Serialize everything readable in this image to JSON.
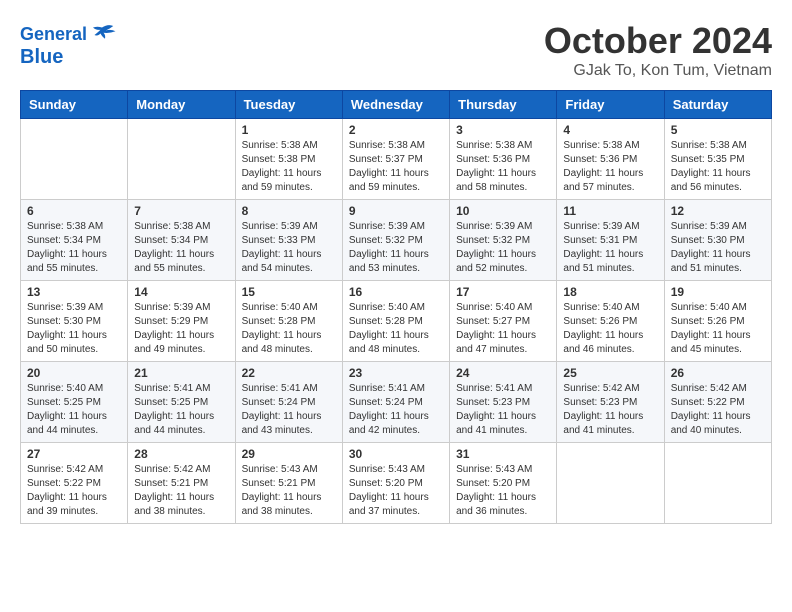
{
  "header": {
    "logo_line1": "General",
    "logo_line2": "Blue",
    "month": "October 2024",
    "location": "GJak To, Kon Tum, Vietnam"
  },
  "weekdays": [
    "Sunday",
    "Monday",
    "Tuesday",
    "Wednesday",
    "Thursday",
    "Friday",
    "Saturday"
  ],
  "weeks": [
    [
      {
        "day": "",
        "data": ""
      },
      {
        "day": "",
        "data": ""
      },
      {
        "day": "1",
        "data": "Sunrise: 5:38 AM\nSunset: 5:38 PM\nDaylight: 11 hours and 59 minutes."
      },
      {
        "day": "2",
        "data": "Sunrise: 5:38 AM\nSunset: 5:37 PM\nDaylight: 11 hours and 59 minutes."
      },
      {
        "day": "3",
        "data": "Sunrise: 5:38 AM\nSunset: 5:36 PM\nDaylight: 11 hours and 58 minutes."
      },
      {
        "day": "4",
        "data": "Sunrise: 5:38 AM\nSunset: 5:36 PM\nDaylight: 11 hours and 57 minutes."
      },
      {
        "day": "5",
        "data": "Sunrise: 5:38 AM\nSunset: 5:35 PM\nDaylight: 11 hours and 56 minutes."
      }
    ],
    [
      {
        "day": "6",
        "data": "Sunrise: 5:38 AM\nSunset: 5:34 PM\nDaylight: 11 hours and 55 minutes."
      },
      {
        "day": "7",
        "data": "Sunrise: 5:38 AM\nSunset: 5:34 PM\nDaylight: 11 hours and 55 minutes."
      },
      {
        "day": "8",
        "data": "Sunrise: 5:39 AM\nSunset: 5:33 PM\nDaylight: 11 hours and 54 minutes."
      },
      {
        "day": "9",
        "data": "Sunrise: 5:39 AM\nSunset: 5:32 PM\nDaylight: 11 hours and 53 minutes."
      },
      {
        "day": "10",
        "data": "Sunrise: 5:39 AM\nSunset: 5:32 PM\nDaylight: 11 hours and 52 minutes."
      },
      {
        "day": "11",
        "data": "Sunrise: 5:39 AM\nSunset: 5:31 PM\nDaylight: 11 hours and 51 minutes."
      },
      {
        "day": "12",
        "data": "Sunrise: 5:39 AM\nSunset: 5:30 PM\nDaylight: 11 hours and 51 minutes."
      }
    ],
    [
      {
        "day": "13",
        "data": "Sunrise: 5:39 AM\nSunset: 5:30 PM\nDaylight: 11 hours and 50 minutes."
      },
      {
        "day": "14",
        "data": "Sunrise: 5:39 AM\nSunset: 5:29 PM\nDaylight: 11 hours and 49 minutes."
      },
      {
        "day": "15",
        "data": "Sunrise: 5:40 AM\nSunset: 5:28 PM\nDaylight: 11 hours and 48 minutes."
      },
      {
        "day": "16",
        "data": "Sunrise: 5:40 AM\nSunset: 5:28 PM\nDaylight: 11 hours and 48 minutes."
      },
      {
        "day": "17",
        "data": "Sunrise: 5:40 AM\nSunset: 5:27 PM\nDaylight: 11 hours and 47 minutes."
      },
      {
        "day": "18",
        "data": "Sunrise: 5:40 AM\nSunset: 5:26 PM\nDaylight: 11 hours and 46 minutes."
      },
      {
        "day": "19",
        "data": "Sunrise: 5:40 AM\nSunset: 5:26 PM\nDaylight: 11 hours and 45 minutes."
      }
    ],
    [
      {
        "day": "20",
        "data": "Sunrise: 5:40 AM\nSunset: 5:25 PM\nDaylight: 11 hours and 44 minutes."
      },
      {
        "day": "21",
        "data": "Sunrise: 5:41 AM\nSunset: 5:25 PM\nDaylight: 11 hours and 44 minutes."
      },
      {
        "day": "22",
        "data": "Sunrise: 5:41 AM\nSunset: 5:24 PM\nDaylight: 11 hours and 43 minutes."
      },
      {
        "day": "23",
        "data": "Sunrise: 5:41 AM\nSunset: 5:24 PM\nDaylight: 11 hours and 42 minutes."
      },
      {
        "day": "24",
        "data": "Sunrise: 5:41 AM\nSunset: 5:23 PM\nDaylight: 11 hours and 41 minutes."
      },
      {
        "day": "25",
        "data": "Sunrise: 5:42 AM\nSunset: 5:23 PM\nDaylight: 11 hours and 41 minutes."
      },
      {
        "day": "26",
        "data": "Sunrise: 5:42 AM\nSunset: 5:22 PM\nDaylight: 11 hours and 40 minutes."
      }
    ],
    [
      {
        "day": "27",
        "data": "Sunrise: 5:42 AM\nSunset: 5:22 PM\nDaylight: 11 hours and 39 minutes."
      },
      {
        "day": "28",
        "data": "Sunrise: 5:42 AM\nSunset: 5:21 PM\nDaylight: 11 hours and 38 minutes."
      },
      {
        "day": "29",
        "data": "Sunrise: 5:43 AM\nSunset: 5:21 PM\nDaylight: 11 hours and 38 minutes."
      },
      {
        "day": "30",
        "data": "Sunrise: 5:43 AM\nSunset: 5:20 PM\nDaylight: 11 hours and 37 minutes."
      },
      {
        "day": "31",
        "data": "Sunrise: 5:43 AM\nSunset: 5:20 PM\nDaylight: 11 hours and 36 minutes."
      },
      {
        "day": "",
        "data": ""
      },
      {
        "day": "",
        "data": ""
      }
    ]
  ]
}
